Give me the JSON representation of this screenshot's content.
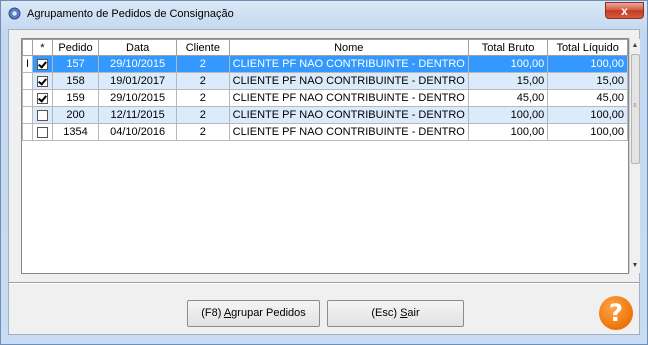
{
  "window": {
    "title": "Agrupamento de Pedidos de Consignação",
    "close_glyph": "x"
  },
  "grid": {
    "columns": [
      "*",
      "Pedido",
      "Data",
      "Cliente",
      "Nome",
      "Total Bruto",
      "Total Líquido"
    ],
    "rows": [
      {
        "checked": true,
        "pedido": "157",
        "data": "29/10/2015",
        "cliente": "2",
        "nome": "CLIENTE PF NAO CONTRIBUINTE - DENTRO",
        "bruto": "100,00",
        "liquido": "100,00",
        "selected": true
      },
      {
        "checked": true,
        "pedido": "158",
        "data": "19/01/2017",
        "cliente": "2",
        "nome": "CLIENTE PF NAO CONTRIBUINTE - DENTRO",
        "bruto": "15,00",
        "liquido": "15,00"
      },
      {
        "checked": true,
        "pedido": "159",
        "data": "29/10/2015",
        "cliente": "2",
        "nome": "CLIENTE PF NAO CONTRIBUINTE - DENTRO",
        "bruto": "45,00",
        "liquido": "45,00"
      },
      {
        "checked": false,
        "pedido": "200",
        "data": "12/11/2015",
        "cliente": "2",
        "nome": "CLIENTE PF NAO CONTRIBUINTE - DENTRO",
        "bruto": "100,00",
        "liquido": "100,00"
      },
      {
        "checked": false,
        "pedido": "1354",
        "data": "04/10/2016",
        "cliente": "2",
        "nome": "CLIENTE PF NAO CONTRIBUINTE - DENTRO",
        "bruto": "100,00",
        "liquido": "100,00"
      }
    ],
    "row_indicator": "I"
  },
  "buttons": {
    "agrupar": {
      "prefix": "(F8) ",
      "hotkey": "A",
      "rest": "grupar Pedidos"
    },
    "sair": {
      "prefix": "(Esc) ",
      "hotkey": "S",
      "rest": "air"
    }
  },
  "help": {
    "glyph": "?"
  },
  "colors": {
    "selection": "#3399ff",
    "alt_row": "#dcebfb",
    "help": "#f07a10"
  }
}
